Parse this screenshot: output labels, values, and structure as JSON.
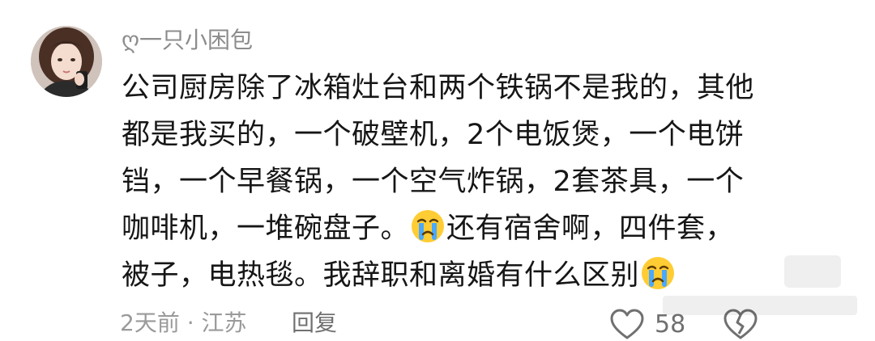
{
  "comment": {
    "username": "ღ一只小困包",
    "text_lines": [
      {
        "before": "公司厨房除了冰箱灶台和两个铁锅不是我的，其他",
        "after": ""
      },
      {
        "before": "都是我买的，一个破壁机，2个电饭煲，一个电饼",
        "after": ""
      },
      {
        "before": "铛，一个早餐锅，一个空气炸锅，2套茶具，一个",
        "after": ""
      },
      {
        "before": "咖啡机，一堆碗盘子。",
        "after": "还有宿舍啊，四件套，"
      },
      {
        "before": "被子，电热毯。我辞职和离婚有什么区别",
        "after": ""
      }
    ],
    "emoji": "crying-face",
    "time_location": "2天前 · 江苏",
    "reply_label": "回复",
    "like_count": "58"
  },
  "colors": {
    "text": "#161616",
    "meta": "#9a9a9a",
    "username": "#8c8c8c"
  }
}
